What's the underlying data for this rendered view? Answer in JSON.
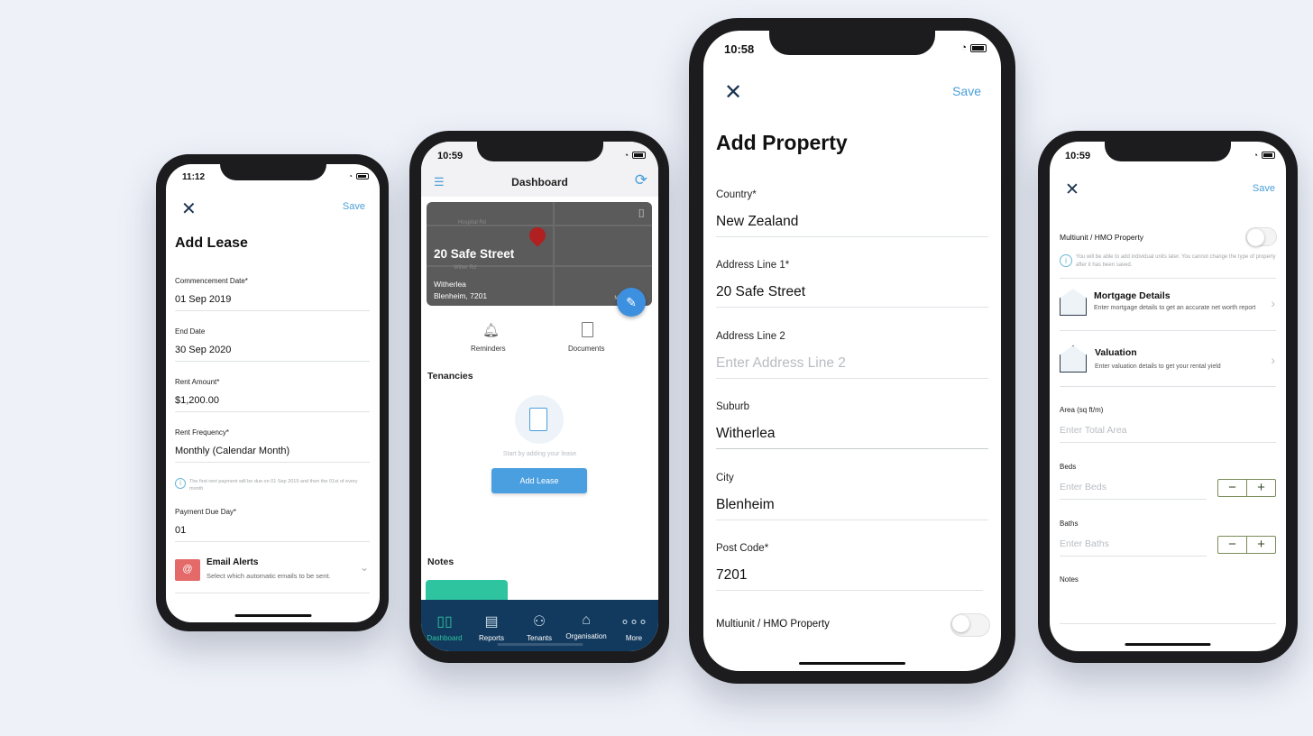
{
  "lease": {
    "time": "11:12",
    "save": "Save",
    "title": "Add Lease",
    "fields": [
      {
        "label": "Commencement Date*",
        "value": "01 Sep 2019"
      },
      {
        "label": "End Date",
        "value": "30 Sep 2020"
      },
      {
        "label": "Rent Amount*",
        "value": "$1,200.00"
      },
      {
        "label": "Rent Frequency*",
        "value": "Monthly (Calendar Month)"
      }
    ],
    "info": "The first rent payment will be due on 01 Sep 2019 and then the 01st of every month",
    "due_label": "Payment Due Day*",
    "due_value": "01",
    "email_title": "Email Alerts",
    "email_sub": "Select which automatic emails to be sent."
  },
  "dashboard": {
    "time": "10:59",
    "title": "Dashboard",
    "map": {
      "street": "20 Safe Street",
      "suburb": "Witherlea",
      "city": "Blenheim, 7201",
      "road1": "Hospital Rd",
      "road2": "Witter Rd",
      "attrib": "Map"
    },
    "reminders": "Reminders",
    "documents": "Documents",
    "tenancies": "Tenancies",
    "empty": "Start by adding your lease",
    "add_lease": "Add Lease",
    "notes": "Notes",
    "tabs": [
      {
        "label": "Dashboard",
        "icon": "dashboard-icon"
      },
      {
        "label": "Reports",
        "icon": "reports-icon"
      },
      {
        "label": "Tenants",
        "icon": "tenants-icon"
      },
      {
        "label": "Organisation",
        "icon": "home-icon"
      },
      {
        "label": "More",
        "icon": "more-icon"
      }
    ],
    "accent": "#2ec4a0",
    "tabbar": "#123a5e"
  },
  "property": {
    "time": "10:58",
    "save": "Save",
    "title": "Add Property",
    "fields": [
      {
        "label": "Country*",
        "value": "New Zealand"
      },
      {
        "label": "Address Line 1*",
        "value": "20 Safe Street"
      },
      {
        "label": "Address Line 2",
        "placeholder": "Enter Address Line 2"
      },
      {
        "label": "Suburb",
        "value": "Witherlea"
      },
      {
        "label": "City",
        "value": "Blenheim"
      },
      {
        "label": "Post Code*",
        "value": "7201"
      }
    ],
    "multiunit": "Multiunit / HMO Property"
  },
  "details": {
    "time": "10:59",
    "save": "Save",
    "multiunit": "Multiunit / HMO Property",
    "info": "You will be able to add individual units later. You cannot change the type of property after it has been saved.",
    "mortgage_title": "Mortgage Details",
    "mortgage_sub": "Enter mortgage details to get an accurate net worth report",
    "valuation_title": "Valuation",
    "valuation_sub": "Enter valuation details to get your rental yield",
    "area_label": "Area (sq ft/m)",
    "area_ph": "Enter Total Area",
    "beds_label": "Beds",
    "beds_ph": "Enter Beds",
    "baths_label": "Baths",
    "baths_ph": "Enter Baths",
    "notes": "Notes",
    "minus": "−",
    "plus": "+"
  }
}
